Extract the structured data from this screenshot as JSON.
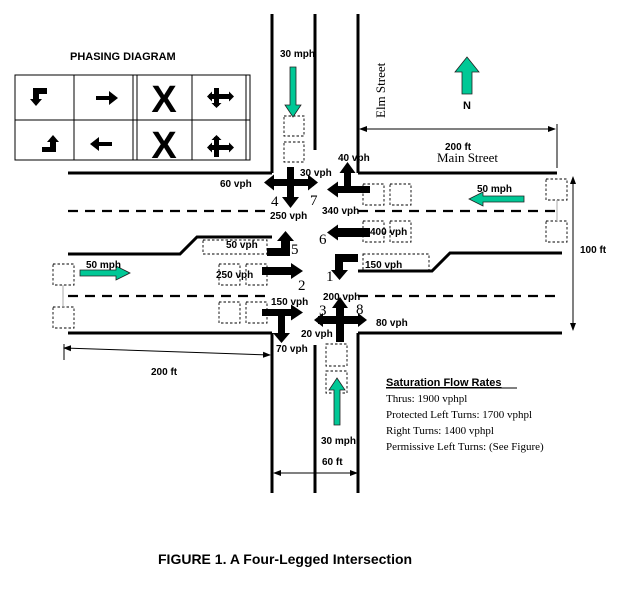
{
  "figure_title": "FIGURE 1.  A Four-Legged Intersection",
  "phasing_diagram": {
    "title": "PHASING DIAGRAM",
    "rows": [
      [
        "left-turn-down-icon",
        "arrow-right-icon",
        "X",
        "cross-arrows-icon"
      ],
      [
        "left-turn-up-icon",
        "arrow-left-icon",
        "X",
        "cross-arrows-icon"
      ]
    ],
    "x_label": "X"
  },
  "streets": {
    "ns_name": "Elm Street",
    "ew_name": "Main Street",
    "north_label": "N"
  },
  "speeds": {
    "southbound": "30 mph",
    "northbound": "30 mph",
    "westbound": "50 mph",
    "eastbound": "50 mph"
  },
  "dimensions": {
    "ew_width_top": "200 ft",
    "ew_width_left": "200 ft",
    "ns_width": "100 ft",
    "approach_width": "60 ft"
  },
  "movements": [
    {
      "id": "1",
      "volume": "150 vph"
    },
    {
      "id": "2",
      "volume": "250 vph"
    },
    {
      "id": "3",
      "volume": "20 vph"
    },
    {
      "id": "4",
      "volume": "60 vph"
    },
    {
      "id": "5",
      "volume": "50 vph"
    },
    {
      "id": "6",
      "volume": "400 vph"
    },
    {
      "id": "7",
      "volume": "30 vph"
    },
    {
      "id": "8",
      "volume": "80 vph"
    }
  ],
  "volumes": {
    "sb_left": "60 vph",
    "sb_through": "250 vph",
    "sb_right": "30 vph",
    "wb_right": "40 vph",
    "wb_through": "340 vph",
    "wb_through_lane2": "400 vph",
    "wb_left": "150 vph",
    "eb_left": "50 vph",
    "eb_through": "250 vph",
    "eb_right_top": "150 vph",
    "eb_right_down": "70 vph",
    "nb_through": "200 vph",
    "nb_left": "20 vph",
    "nb_right": "80 vph"
  },
  "saturation": {
    "title": "Saturation Flow Rates",
    "lines": [
      "Thrus:  1900 vphpl",
      "Protected Left Turns:  1700 vphpl",
      "Right Turns:  1400 vphpl",
      "Permissive Left Turns: (See Figure)"
    ]
  },
  "colors": {
    "speed_arrow": "#00c896",
    "ink": "#000000"
  }
}
